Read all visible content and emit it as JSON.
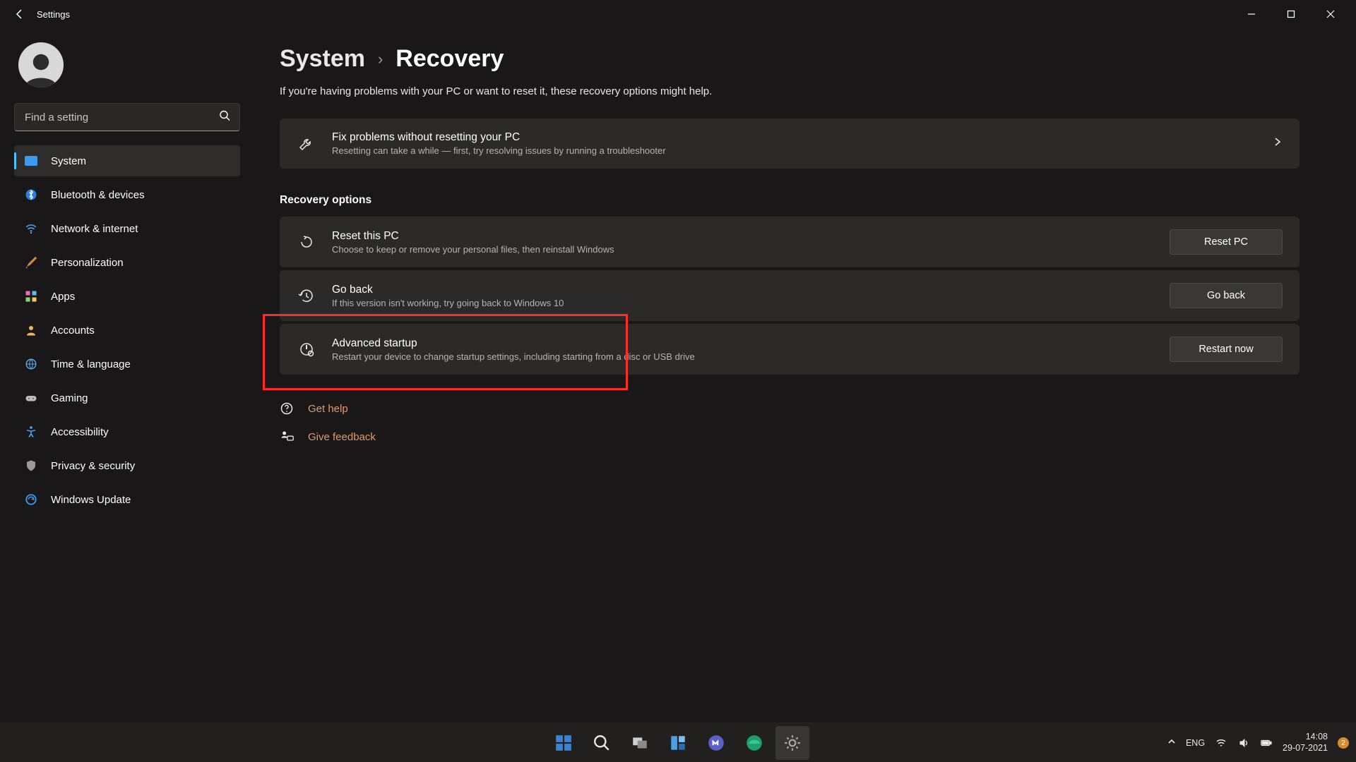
{
  "titlebar": {
    "app_name": "Settings"
  },
  "search": {
    "placeholder": "Find a setting"
  },
  "nav": {
    "items": [
      {
        "label": "System"
      },
      {
        "label": "Bluetooth & devices"
      },
      {
        "label": "Network & internet"
      },
      {
        "label": "Personalization"
      },
      {
        "label": "Apps"
      },
      {
        "label": "Accounts"
      },
      {
        "label": "Time & language"
      },
      {
        "label": "Gaming"
      },
      {
        "label": "Accessibility"
      },
      {
        "label": "Privacy & security"
      },
      {
        "label": "Windows Update"
      }
    ]
  },
  "breadcrumb": {
    "parent": "System",
    "current": "Recovery"
  },
  "page": {
    "subtitle": "If you're having problems with your PC or want to reset it, these recovery options might help."
  },
  "fix_card": {
    "title": "Fix problems without resetting your PC",
    "desc": "Resetting can take a while — first, try resolving issues by running a troubleshooter"
  },
  "recovery_section_title": "Recovery options",
  "options": {
    "reset": {
      "title": "Reset this PC",
      "desc": "Choose to keep or remove your personal files, then reinstall Windows",
      "button": "Reset PC"
    },
    "goback": {
      "title": "Go back",
      "desc": "If this version isn't working, try going back to Windows 10",
      "button": "Go back"
    },
    "advanced": {
      "title": "Advanced startup",
      "desc": "Restart your device to change startup settings, including starting from a disc or USB drive",
      "button": "Restart now"
    }
  },
  "links": {
    "help": "Get help",
    "feedback": "Give feedback"
  },
  "taskbar": {
    "lang": "ENG",
    "time": "14:08",
    "date": "29-07-2021",
    "notification_count": "2"
  }
}
